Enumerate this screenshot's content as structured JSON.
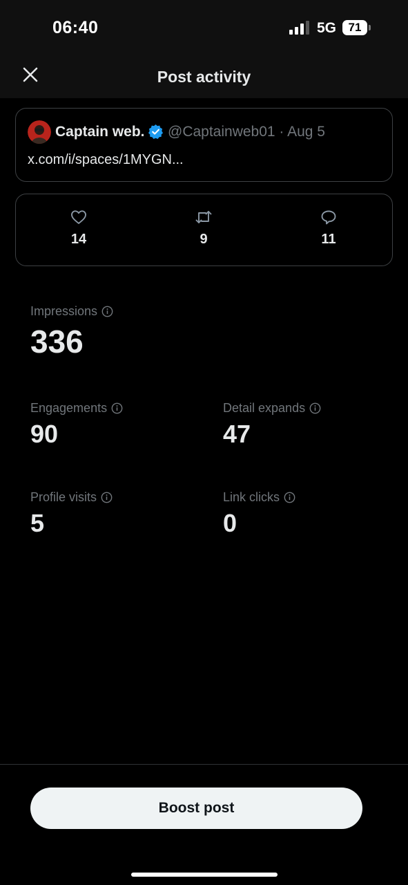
{
  "status_bar": {
    "time": "06:40",
    "network": "5G",
    "battery": "71"
  },
  "header": {
    "title": "Post activity",
    "close_icon": "close-icon"
  },
  "post": {
    "author_name": "Captain web.",
    "handle_date": "@Captainweb01 · Aug 5",
    "text": "x.com/i/spaces/1MYGN..."
  },
  "engagement": {
    "likes": "14",
    "reposts": "9",
    "replies": "11"
  },
  "metrics": {
    "impressions": {
      "label": "Impressions",
      "value": "336"
    },
    "engagements": {
      "label": "Engagements",
      "value": "90"
    },
    "detail_expands": {
      "label": "Detail expands",
      "value": "47"
    },
    "profile_visits": {
      "label": "Profile visits",
      "value": "5"
    },
    "link_clicks": {
      "label": "Link clicks",
      "value": "0"
    }
  },
  "footer": {
    "boost_label": "Boost post"
  },
  "colors": {
    "accent": "#1d9bf0",
    "background": "#000000",
    "muted": "#71767b",
    "button_bg": "#eff3f4"
  }
}
